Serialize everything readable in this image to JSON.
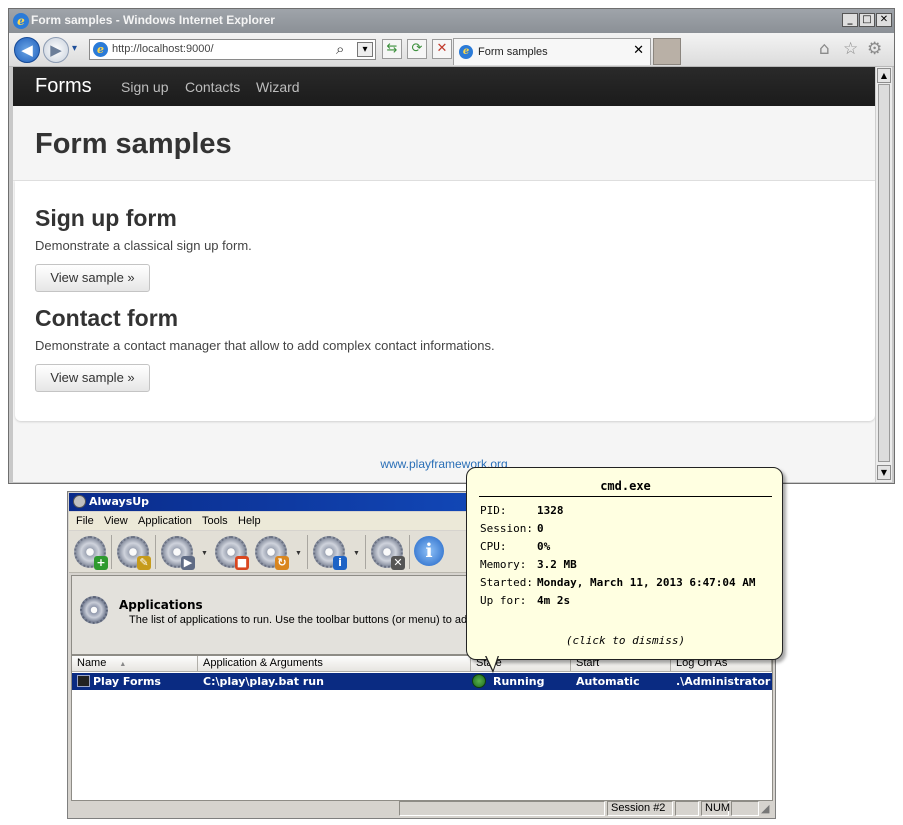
{
  "ie": {
    "title": "Form samples - Windows Internet Explorer",
    "address": "http://localhost:9000/",
    "tab_title": "Form samples",
    "tab_close": "✕",
    "buttons": {
      "back": "◀",
      "forward": "▶",
      "compat": "⇆",
      "refresh": "⟳",
      "stop": "✕",
      "home": "⌂",
      "favorites": "☆",
      "tools": "⚙",
      "search": "⌕",
      "dropdown": "▾"
    },
    "window_buttons": {
      "minimize": "_",
      "maximize": "□",
      "close": "✕"
    }
  },
  "page": {
    "brand": "Forms",
    "nav": [
      "Sign up",
      "Contacts",
      "Wizard"
    ],
    "hero_title": "Form samples",
    "sections": [
      {
        "title": "Sign up form",
        "description": "Demonstrate a classical sign up form.",
        "button": "View sample »"
      },
      {
        "title": "Contact form",
        "description": "Demonstrate a contact manager that allow to add complex contact informations.",
        "button": "View sample »"
      }
    ],
    "footer_link": "www.playframework.org"
  },
  "alwaysup": {
    "title": "AlwaysUp",
    "menu": [
      "File",
      "View",
      "Application",
      "Tools",
      "Help"
    ],
    "panel_title": "Applications",
    "panel_desc": "The list of applications to run. Use the toolbar buttons (or menu) to add, edit, start and stop them.",
    "info_icon_glyph": "i",
    "columns": [
      "Name",
      "Application & Arguments",
      "State",
      "Start",
      "Log On As"
    ],
    "sort_indicator": "▲",
    "rows": [
      {
        "name": "Play Forms",
        "app": "C:\\play\\play.bat run",
        "state": "Running",
        "start": "Automatic",
        "logon": ".\\Administrator"
      }
    ],
    "status": {
      "session": "Session #2",
      "num": "NUM"
    }
  },
  "tooltip": {
    "title": "cmd.exe",
    "fields": [
      {
        "k": "PID:",
        "v": "1328"
      },
      {
        "k": "Session:",
        "v": "0"
      },
      {
        "k": "CPU:",
        "v": "0%"
      },
      {
        "k": "Memory:",
        "v": "3.2 MB"
      },
      {
        "k": "Started:",
        "v": "Monday, March 11, 2013 6:47:04 AM"
      },
      {
        "k": "Up for:",
        "v": "4m 2s"
      }
    ],
    "dismiss": "(click to dismiss)"
  },
  "colors": {
    "ie_navbar": "#1b1b1b",
    "link": "#2a6fb7",
    "au_selection": "#0a2b82",
    "tooltip_bg": "#ffffe1",
    "running_dot": "#2f8a2f"
  }
}
